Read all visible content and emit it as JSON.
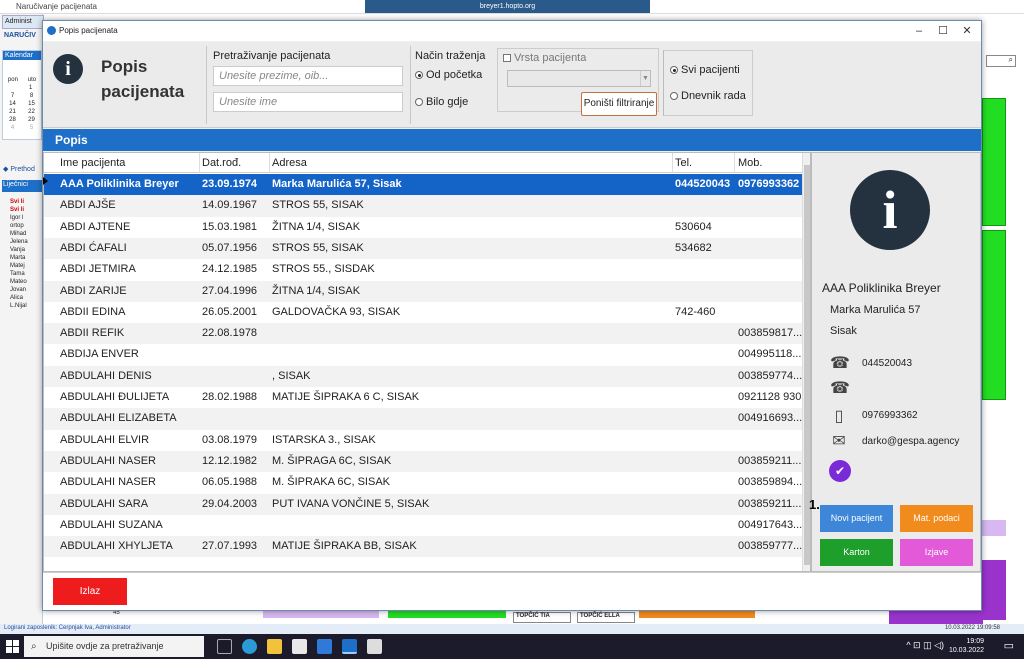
{
  "background_app": {
    "title": "Naručivanje pacijenata",
    "rdp_title": "breyer1.hopto.org",
    "tab_label": "Administ",
    "section_label": "NARUČIV",
    "calendar_label": "Kalendar",
    "calendar_days": [
      "pon",
      "uto"
    ],
    "calendar_rows": [
      [
        "",
        "1"
      ],
      [
        "7",
        "8"
      ],
      [
        "14",
        "15"
      ],
      [
        "21",
        "22"
      ],
      [
        "28",
        "29"
      ],
      [
        "4",
        "5"
      ]
    ],
    "prev_label": "Prethod",
    "lijecnici_label": "Liječnici",
    "lijecnici": [
      "Svi li",
      "Svi li",
      "Igor l",
      "ortop",
      "Mihad",
      "Jelena",
      "Vanja",
      "Marta",
      "Matej",
      "Tama",
      "Mateo",
      "Jovan",
      "Alica",
      "L.Nijal"
    ],
    "bottom_labels": [
      "45",
      "TOPČIĆ TIA",
      "TOPČIĆ ELLA"
    ],
    "status": "Logirani zaposlenik: Cerpnjak Iva, Administrator",
    "status_datetime": "10.03.2022 19:09:58"
  },
  "taskbar": {
    "search_placeholder": "Upišite ovdje za pretraživanje",
    "time": "19:09",
    "date": "10.03.2022"
  },
  "dialog": {
    "title": "Popis pacijenata",
    "header_title": "Popis pacijenata",
    "search_label": "Pretraživanje pacijenata",
    "search_placeholder_1": "Unesite prezime, oib...",
    "search_placeholder_2": "Unesite ime",
    "nacin_label": "Način traženja",
    "nacin_opt1": "Od početka",
    "nacin_opt2": "Bilo gdje",
    "vrsta_label": "Vrsta pacijenta",
    "ponisti_label": "Poništi filtriranje",
    "svi_label": "Svi pacijenti",
    "dnevnik_label": "Dnevnik rada",
    "popis_label": "Popis",
    "columns": [
      "Ime pacijenta",
      "Dat.rođ.",
      "Adresa",
      "Tel.",
      "Mob."
    ],
    "rows": [
      [
        "AAA Poliklinika Breyer",
        "23.09.1974",
        "Marka Marulića 57, Sisak",
        "044520043",
        "0976993362"
      ],
      [
        "ABDI AJŠE",
        "14.09.1967",
        "STROS 55, SISAK",
        "",
        ""
      ],
      [
        "ABDI AJTENE",
        "15.03.1981",
        "ŽITNA 1/4, SISAK",
        "530604",
        ""
      ],
      [
        "ABDI ĆAFALI",
        "05.07.1956",
        "STROS 55, SISAK",
        "534682",
        ""
      ],
      [
        "ABDI JETMIRA",
        "24.12.1985",
        "STROS 55., SISDAK",
        "",
        ""
      ],
      [
        "ABDI ZARIJE",
        "27.04.1996",
        "ŽITNA 1/4, SISAK",
        "",
        ""
      ],
      [
        "ABDII EDINA",
        "26.05.2001",
        "GALDOVAČKA 93, SISAK",
        "742-460",
        ""
      ],
      [
        "ABDII REFIK",
        "22.08.1978",
        "",
        "",
        "003859817..."
      ],
      [
        "ABDIJA ENVER",
        "",
        "",
        "",
        "004995118..."
      ],
      [
        "ABDULAHI DENIS",
        "",
        ", SISAK",
        "",
        "003859774..."
      ],
      [
        "ABDULAHI ĐULIJETA",
        "28.02.1988",
        "MATIJE ŠIPRAKA 6 C, SISAK",
        "",
        "0921128 930"
      ],
      [
        "ABDULAHI ELIZABETA",
        "",
        "",
        "",
        "004916693..."
      ],
      [
        "ABDULAHI ELVIR",
        "03.08.1979",
        "ISTARSKA 3., SISAK",
        "",
        ""
      ],
      [
        "ABDULAHI NASER",
        "12.12.1982",
        "M. ŠIPRAGA 6C, SISAK",
        "",
        "003859211..."
      ],
      [
        "ABDULAHI NASER",
        "06.05.1988",
        "M. ŠIPRAKA 6C, SISAK",
        "",
        "003859894..."
      ],
      [
        "ABDULAHI SARA",
        "29.04.2003",
        "PUT IVANA VONČINE 5, SISAK",
        "",
        "003859211..."
      ],
      [
        "ABDULAHI SUZANA",
        "",
        "",
        "",
        "004917643..."
      ],
      [
        "ABDULAHI XHYLJETA",
        "27.07.1993",
        "MATIJE ŠIPRAKA BB, SISAK",
        "",
        "003859777..."
      ]
    ],
    "detail": {
      "name": "AAA Poliklinika Breyer",
      "street": "Marka Marulića 57",
      "city": "Sisak",
      "phone": "044520043",
      "phone2": "",
      "mobile": "0976993362",
      "email": "darko@gespa.agency"
    },
    "annotation": "1.",
    "buttons": {
      "novi": "Novi pacijent",
      "mat": "Mat. podaci",
      "karton": "Karton",
      "izjave": "Izjave",
      "izlaz": "Izlaz"
    },
    "colors": {
      "accent": "#1e6fc8",
      "selected_row": "#1464c8",
      "exit": "#ee1c1c"
    }
  }
}
